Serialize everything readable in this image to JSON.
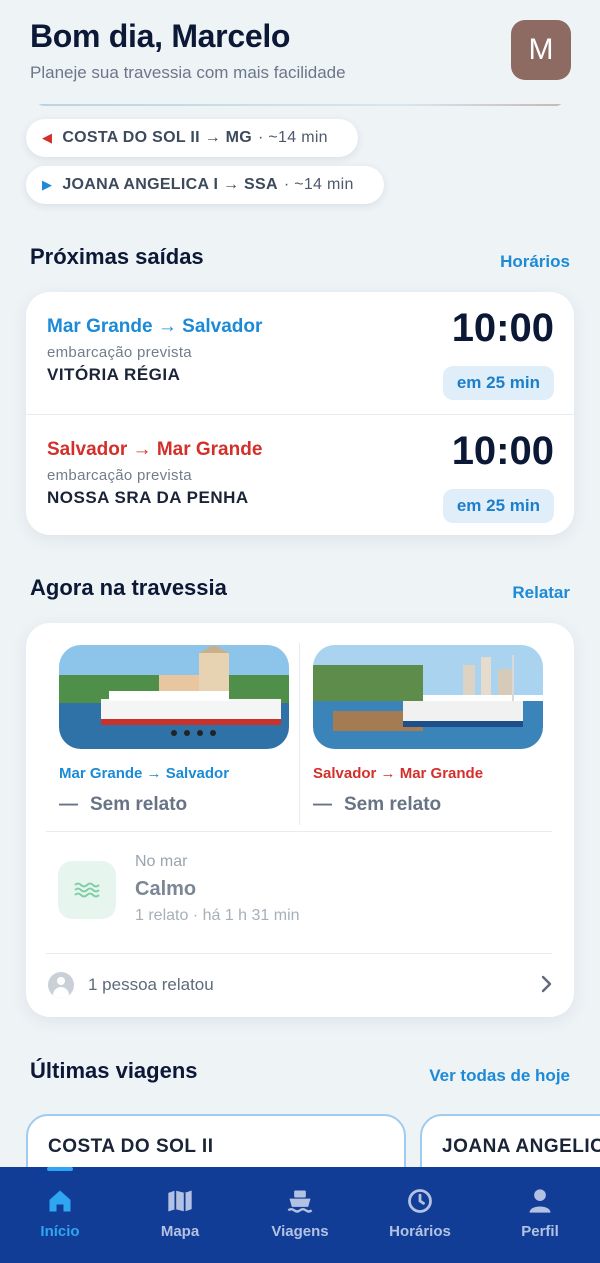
{
  "header": {
    "greeting": "Bom dia, Marcelo",
    "subtitle": "Planeje sua travessia com mais facilidade",
    "avatar_initial": "M",
    "avatar_color": "#8d6a62"
  },
  "map_chips": [
    {
      "direction_icon": "arrow-left-icon",
      "color": "#d3302b",
      "vessel": "COSTA DO SOL II",
      "dest": "MG",
      "eta": "~14 min"
    },
    {
      "direction_icon": "arrow-right-icon",
      "color": "#1c8ad6",
      "vessel": "JOANA ANGELICA I",
      "dest": "SSA",
      "eta": "~14 min"
    }
  ],
  "chip_labels": {
    "c0": "COSTA DO SOL II → MG",
    "c0_eta": "· ~14 min",
    "c1": "JOANA ANGELICA I → SSA",
    "c1_eta": "· ~14 min"
  },
  "departures": {
    "title": "Próximas saídas",
    "link": "Horários",
    "items": [
      {
        "route": "Mar Grande → Salvador",
        "route_color": "#1c8ad6",
        "label": "embarcação prevista",
        "vessel": "VITÓRIA RÉGIA",
        "time": "10:00",
        "badge": "em 25 min"
      },
      {
        "route": "Salvador → Mar Grande",
        "route_color": "#d3302b",
        "label": "embarcação prevista",
        "vessel": "NOSSA SRA DA PENHA",
        "time": "10:00",
        "badge": "em 25 min"
      }
    ]
  },
  "crossing": {
    "title": "Agora na travessia",
    "link": "Relatar",
    "terminals": [
      {
        "route": "Mar Grande → Salvador",
        "route_color": "#1c8ad6",
        "status_icon": "dash",
        "status": "Sem relato"
      },
      {
        "route": "Salvador → Mar Grande",
        "route_color": "#d3302b",
        "status_icon": "dash",
        "status": "Sem relato"
      }
    ],
    "sea": {
      "icon": "waves-icon",
      "label": "No mar",
      "value": "Calmo",
      "meta": "1 relato · há 1 h 31 min"
    },
    "people": {
      "icon": "person-icon",
      "text": "1 pessoa relatou"
    }
  },
  "trips": {
    "title": "Últimas viagens",
    "link": "Ver todas de hoje",
    "items": [
      {
        "vessel": "COSTA DO SOL II"
      },
      {
        "vessel": "JOANA ANGELICA I"
      }
    ]
  },
  "nav": {
    "active": "Início",
    "active_color": "#2fa6f2",
    "background": "#123d96",
    "items": [
      {
        "label": "Início",
        "icon": "home-icon"
      },
      {
        "label": "Mapa",
        "icon": "map-icon"
      },
      {
        "label": "Viagens",
        "icon": "ferry-icon"
      },
      {
        "label": "Horários",
        "icon": "clock-icon"
      },
      {
        "label": "Perfil",
        "icon": "person-icon"
      }
    ]
  }
}
